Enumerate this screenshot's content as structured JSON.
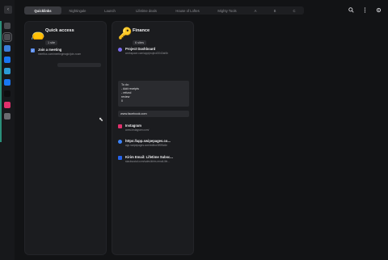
{
  "tabs": [
    {
      "label": "Quicklinks",
      "active": true,
      "width": 46
    },
    {
      "label": "Nightingale",
      "active": false,
      "width": 40
    },
    {
      "label": "Launch",
      "active": false,
      "width": 40
    },
    {
      "label": "Lifetime deals",
      "active": false,
      "width": 50
    },
    {
      "label": "House of Loftes",
      "active": false,
      "width": 52
    },
    {
      "label": "Mighty Tools",
      "active": false,
      "width": 46
    },
    {
      "label": "A",
      "active": false,
      "width": 24
    },
    {
      "label": "B",
      "active": false,
      "width": 24
    },
    {
      "label": "C",
      "active": false,
      "width": 24
    }
  ],
  "rail_icons": [
    {
      "name": "home-icon",
      "color": "#4a4b50"
    },
    {
      "name": "inbox-icon",
      "color": "#4a4b50",
      "selected": true
    },
    {
      "name": "app-icon",
      "color": "#3b7fd9"
    },
    {
      "name": "facebook-icon",
      "color": "#1877f2"
    },
    {
      "name": "doc-icon",
      "color": "#2b9bd6"
    },
    {
      "name": "facebook-icon",
      "color": "#1877f2"
    },
    {
      "name": "terminal-icon",
      "color": "#0d0d0f"
    },
    {
      "name": "instagram-icon",
      "color": "#e1306c"
    },
    {
      "name": "notes-icon",
      "color": "#6a6b70"
    }
  ],
  "top_icons": [
    "search-icon",
    "more-icon",
    "settings-icon"
  ],
  "cards": {
    "quick_access": {
      "emoji": "👝",
      "title": "Quick access",
      "count": "1 site",
      "items": [
        {
          "title": "Join a meeting",
          "subtitle": "meetfox.com/meetingmagic/join-room",
          "icon": "video-icon",
          "color": "#5a8dee"
        }
      ]
    },
    "finance": {
      "emoji": "🔑",
      "title": "Finance",
      "count": "6 sites",
      "items": [
        {
          "title": "Project Dashboard",
          "subtitle": "workspace.com/app/project/2043af4b",
          "icon": "project-icon",
          "color": "#7b6cf0"
        },
        {
          "title": "Instagram",
          "subtitle": "www.instagram.com/",
          "icon": "instagram-icon",
          "color": "#e1306c"
        },
        {
          "title": "https://app.swipepages.co...",
          "subtitle": "app.swipepages.com/editor/2f0f5c6e",
          "icon": "swipe-icon",
          "color": "#3b82f6"
        },
        {
          "title": "Kirim Email: Lifetime Subsc...",
          "subtitle": "stacksocial.com/sales/kirim-email-life...",
          "icon": "mail-icon",
          "color": "#2563eb"
        }
      ],
      "note": [
        "To do:",
        "- Add receipts",
        "- refund",
        "review",
        "0"
      ],
      "url": "www.facebook.com"
    }
  }
}
